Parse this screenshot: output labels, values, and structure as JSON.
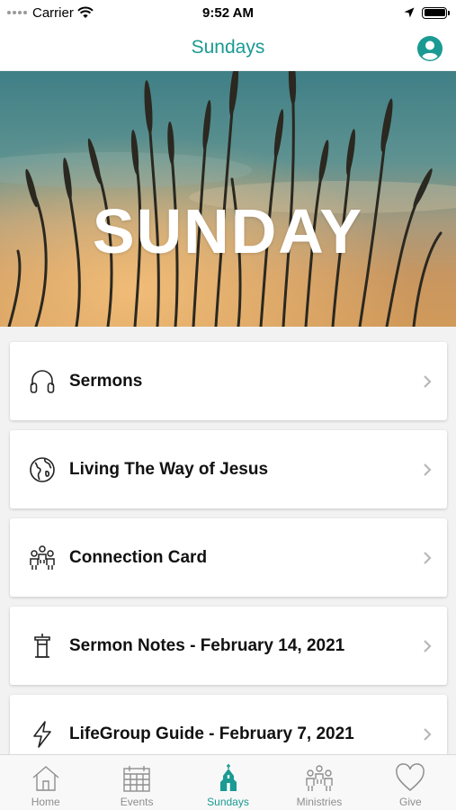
{
  "status_bar": {
    "carrier": "Carrier",
    "time": "9:52 AM"
  },
  "nav": {
    "title": "Sundays",
    "profile_icon": "user-circle-icon"
  },
  "hero": {
    "title": "SUNDAY"
  },
  "menu": [
    {
      "label": "Sermons",
      "icon": "headphones-icon"
    },
    {
      "label": "Living The Way of Jesus",
      "icon": "globe-icon"
    },
    {
      "label": "Connection Card",
      "icon": "people-icon"
    },
    {
      "label": "Sermon Notes -  February 14, 2021",
      "icon": "lectern-icon"
    },
    {
      "label": "LifeGroup Guide - February 7, 2021",
      "icon": "lightning-icon"
    }
  ],
  "tabs": [
    {
      "label": "Home",
      "icon": "home-icon",
      "active": false
    },
    {
      "label": "Events",
      "icon": "calendar-icon",
      "active": false
    },
    {
      "label": "Sundays",
      "icon": "church-icon",
      "active": true
    },
    {
      "label": "Ministries",
      "icon": "people-icon",
      "active": false
    },
    {
      "label": "Give",
      "icon": "heart-icon",
      "active": false
    }
  ],
  "colors": {
    "accent": "#1a9a93",
    "inactive": "#8e8e8e"
  }
}
